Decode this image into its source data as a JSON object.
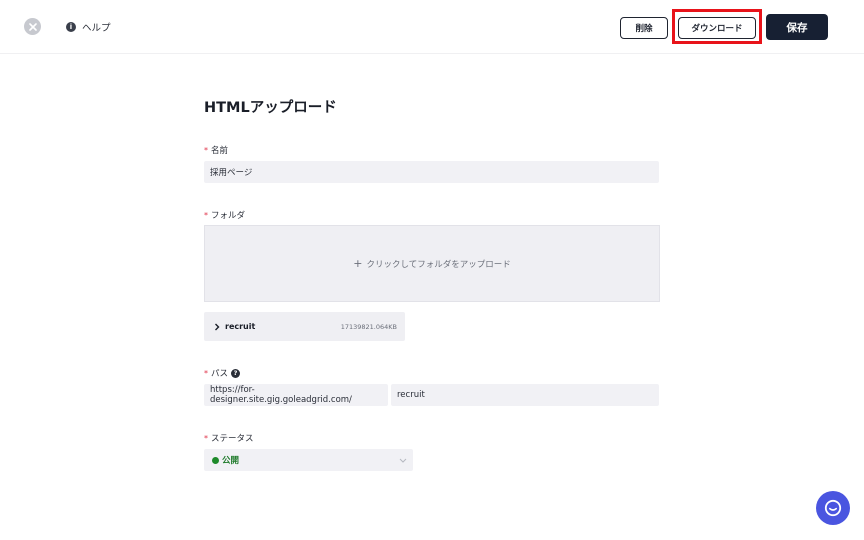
{
  "header": {
    "help_label": "ヘルプ",
    "delete_label": "削除",
    "download_label": "ダウンロード",
    "save_label": "保存"
  },
  "form": {
    "title": "HTMLアップロード",
    "required_mark": "*",
    "name": {
      "label": "名前",
      "value": "採用ページ"
    },
    "folder": {
      "label": "フォルダ",
      "upload_prompt": "クリックしてフォルダをアップロード",
      "file": {
        "name": "recruit",
        "size": "17139821.064KB"
      }
    },
    "path": {
      "label": "パス",
      "prefix": "https://for-designer.site.gig.goleadgrid.com/",
      "value": "recruit"
    },
    "status": {
      "label": "ステータス",
      "selected": "公開"
    }
  },
  "colors": {
    "accent_dark": "#172033",
    "highlight": "#e8131a",
    "status_green": "#1e8a2a",
    "chat": "#4a55e0"
  },
  "icons": [
    "close-icon",
    "info-icon",
    "plus-icon",
    "chevron-right-icon",
    "question-icon",
    "chevron-down-icon",
    "chat-icon"
  ]
}
